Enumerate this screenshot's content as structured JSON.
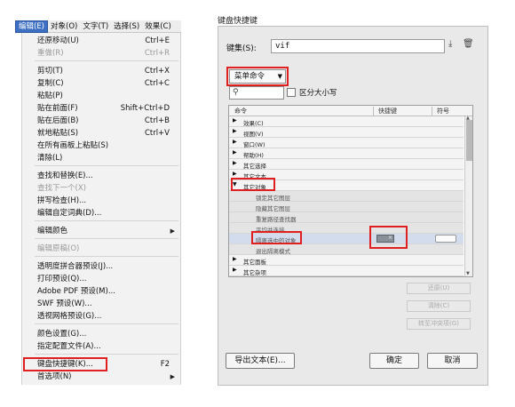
{
  "menubar": {
    "items": [
      "编辑(E)",
      "对象(O)",
      "文字(T)",
      "选择(S)",
      "效果(C)"
    ]
  },
  "edit_menu": {
    "items": [
      {
        "label": "还原移动(U)",
        "shortcut": "Ctrl+E",
        "disabled": false
      },
      {
        "label": "重做(R)",
        "shortcut": "Ctrl+R",
        "disabled": true
      },
      {
        "label": "剪切(T)",
        "shortcut": "Ctrl+X",
        "disabled": false
      },
      {
        "label": "复制(C)",
        "shortcut": "Ctrl+C",
        "disabled": false
      },
      {
        "label": "粘贴(P)",
        "shortcut": "",
        "disabled": false
      },
      {
        "label": "贴在前面(F)",
        "shortcut": "Shift+Ctrl+D",
        "disabled": false
      },
      {
        "label": "贴在后面(B)",
        "shortcut": "Ctrl+B",
        "disabled": false
      },
      {
        "label": "就地粘贴(S)",
        "shortcut": "Ctrl+V",
        "disabled": false
      },
      {
        "label": "在所有画板上粘贴(S)",
        "shortcut": "",
        "disabled": false
      },
      {
        "label": "清除(L)",
        "shortcut": "",
        "disabled": false
      },
      {
        "label": "查找和替换(E)...",
        "shortcut": "",
        "disabled": false
      },
      {
        "label": "查找下一个(X)",
        "shortcut": "",
        "disabled": true
      },
      {
        "label": "拼写检查(H)...",
        "shortcut": "",
        "disabled": false
      },
      {
        "label": "编辑自定词典(D)...",
        "shortcut": "",
        "disabled": false
      },
      {
        "label": "编辑颜色",
        "shortcut": "",
        "disabled": false,
        "submenu": true
      },
      {
        "label": "编辑原稿(O)",
        "shortcut": "",
        "disabled": true
      },
      {
        "label": "透明度拼合器预设(J)...",
        "shortcut": "",
        "disabled": false
      },
      {
        "label": "打印预设(Q)...",
        "shortcut": "",
        "disabled": false
      },
      {
        "label": "Adobe PDF 预设(M)...",
        "shortcut": "",
        "disabled": false
      },
      {
        "label": "SWF 预设(W)...",
        "shortcut": "",
        "disabled": false
      },
      {
        "label": "透视网格预设(G)...",
        "shortcut": "",
        "disabled": false
      },
      {
        "label": "颜色设置(G)...",
        "shortcut": "",
        "disabled": false
      },
      {
        "label": "指定配置文件(A)...",
        "shortcut": "",
        "disabled": false
      },
      {
        "label": "键盘快捷键(K)...",
        "shortcut": "F2",
        "disabled": false,
        "highlighted": true
      },
      {
        "label": "首选项(N)",
        "shortcut": "",
        "disabled": false,
        "submenu": true
      }
    ]
  },
  "dialog": {
    "title": "键盘快捷键",
    "set_label": "键集(S):",
    "set_value": "vif",
    "category_select": "菜单命令",
    "search_placeholder": "",
    "case_checkbox_label": "区分大小写",
    "columns": [
      "命令",
      "快捷键",
      "符号"
    ],
    "rows": [
      {
        "label": "效果(C)",
        "expanded": false,
        "child": false
      },
      {
        "label": "视图(V)",
        "expanded": false,
        "child": false
      },
      {
        "label": "窗口(W)",
        "expanded": false,
        "child": false
      },
      {
        "label": "帮助(H)",
        "expanded": false,
        "child": false
      },
      {
        "label": "其它选择",
        "expanded": false,
        "child": false
      },
      {
        "label": "其它文本",
        "expanded": false,
        "child": false
      },
      {
        "label": "其它对象",
        "expanded": true,
        "child": false,
        "highlighted": true
      },
      {
        "label": "锁定其它图层",
        "child": true
      },
      {
        "label": "隐藏其它图层",
        "child": true
      },
      {
        "label": "重复路径查找器",
        "child": true
      },
      {
        "label": "平均并连接",
        "child": true
      },
      {
        "label": "隔离选中的对象",
        "child": true,
        "selected": true
      },
      {
        "label": "退出隔离模式",
        "child": true
      },
      {
        "label": "其它面板",
        "expanded": false,
        "child": false
      },
      {
        "label": "其它杂项",
        "expanded": false,
        "child": false
      }
    ],
    "side_buttons": [
      "还原(U)",
      "清除(C)",
      "转至冲突项(G)"
    ],
    "export_button": "导出文本(E)...",
    "ok_button": "确定",
    "cancel_button": "取消"
  },
  "colors": {
    "menu_highlight": "#3d6fc2",
    "annotation_red": "#e02020"
  }
}
